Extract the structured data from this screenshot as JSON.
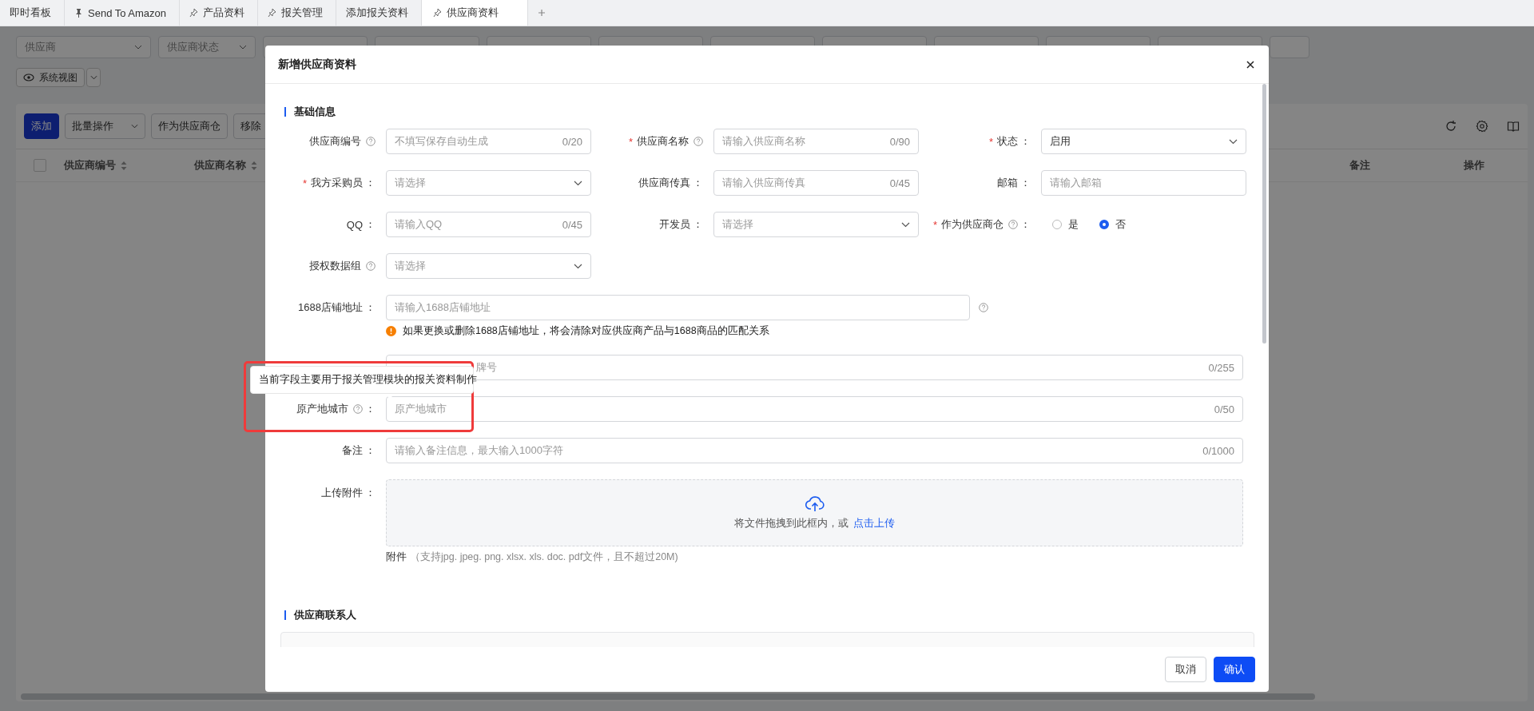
{
  "tabs": [
    {
      "label": "即时看板",
      "kind": "plain",
      "selected": false
    },
    {
      "label": "Send To Amazon",
      "kind": "fixed",
      "selected": false
    },
    {
      "label": "产品资料",
      "kind": "pinned",
      "selected": false
    },
    {
      "label": "报关管理",
      "kind": "pinned",
      "selected": false
    },
    {
      "label": "添加报关资料",
      "kind": "plain",
      "selected": false
    },
    {
      "label": "供应商资料",
      "kind": "pinned",
      "selected": true
    }
  ],
  "filters": [
    {
      "placeholder": "供应商"
    },
    {
      "placeholder": "供应商状态"
    }
  ],
  "view_button": {
    "label": "系统视图"
  },
  "toolbar": [
    {
      "label": "添加",
      "kind": "primary"
    },
    {
      "label": "批量操作",
      "kind": "dropdown"
    },
    {
      "label": "作为供应商仓",
      "kind": "plain"
    },
    {
      "label": "移除",
      "kind": "plain"
    }
  ],
  "table": {
    "select_all": {
      "checked": false
    },
    "columns": [
      {
        "label": "供应商编号",
        "sortable": true
      },
      {
        "label": "供应商名称",
        "sortable": true
      },
      {
        "label": "备注",
        "sortable": false
      },
      {
        "label": "操作",
        "sortable": false
      }
    ]
  },
  "modal": {
    "title": "新增供应商资料",
    "section_basic": "基础信息",
    "grid_fields": [
      {
        "label": "供应商编号",
        "help": true,
        "kind": "text",
        "placeholder": "不填写保存自动生成",
        "counter": "0/20"
      },
      {
        "required_mark": "*",
        "label": "供应商名称",
        "help": true,
        "kind": "text",
        "placeholder": "请输入供应商名称",
        "counter": "0/90"
      },
      {
        "required_mark": "*",
        "label": "状态",
        "help": false,
        "suffix": "：",
        "kind": "select",
        "value": "启用"
      },
      {
        "required_mark": "*",
        "label": "我方采购员",
        "help": false,
        "suffix": "：",
        "kind": "select",
        "placeholder": "请选择"
      },
      {
        "label": "供应商传真",
        "help": false,
        "suffix": "：",
        "kind": "text",
        "placeholder": "请输入供应商传真",
        "counter": "0/45"
      },
      {
        "label": "邮箱",
        "help": false,
        "suffix": "：",
        "kind": "text",
        "placeholder": "请输入邮箱"
      },
      {
        "label": "QQ",
        "help": false,
        "suffix": "：",
        "kind": "text",
        "placeholder": "请输入QQ",
        "counter": "0/45"
      },
      {
        "label": "开发员",
        "help": false,
        "suffix": "：",
        "kind": "select",
        "placeholder": "请选择"
      },
      {
        "required_mark": "*",
        "label": "作为供应商仓",
        "help": true,
        "suffix": "：",
        "kind": "radio",
        "options": [
          {
            "label": "是",
            "selected": false
          },
          {
            "label": "否",
            "selected": true
          }
        ]
      },
      {
        "label": "授权数据组",
        "help": true,
        "kind": "select",
        "placeholder": "请选择"
      }
    ],
    "shop_field": {
      "label": "1688店铺地址",
      "suffix": "：",
      "placeholder": "请输入1688店铺地址",
      "warning": "如果更换或删除1688店铺地址，将会清除对应供应商产品与1688商品的匹配关系"
    },
    "brand_field": {
      "placeholder": "牌号",
      "counter": "0/255"
    },
    "tooltip": "当前字段主要用于报关管理模块的报关资料制作",
    "wide_fields": [
      {
        "label": "原产地城市",
        "help": true,
        "suffix": "：",
        "placeholder": "原产地城市",
        "counter": "0/50"
      },
      {
        "label": "备注",
        "help": false,
        "suffix": "：",
        "placeholder": "请输入备注信息，最大输入1000字符",
        "counter": "0/1000"
      }
    ],
    "upload": {
      "label": "上传附件",
      "suffix": "：",
      "text": "将文件拖拽到此框内，或",
      "link": "点击上传",
      "hint_label": "附件",
      "hint": "（支持jpg. jpeg. png. xlsx. xls. doc. pdf文件，且不超过20M)"
    },
    "section_contacts": "供应商联系人",
    "buttons": [
      {
        "label": "取消",
        "kind": "plain"
      },
      {
        "label": "确认",
        "kind": "primary"
      }
    ]
  }
}
